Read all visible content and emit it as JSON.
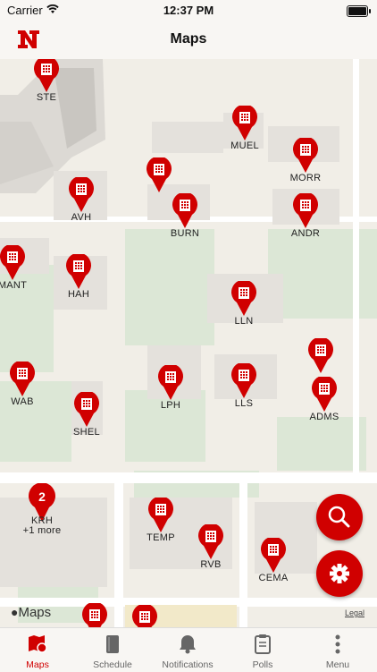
{
  "status": {
    "carrier": "Carrier",
    "time": "12:37 PM"
  },
  "header": {
    "title": "Maps"
  },
  "map": {
    "attribution": "Maps",
    "legal": "Legal",
    "pins": [
      {
        "label": "STE"
      },
      {
        "label": "MUEL"
      },
      {
        "label": "MORR"
      },
      {
        "label": "AVH"
      },
      {
        "label": "BURN"
      },
      {
        "label": "ANDR"
      },
      {
        "label": "MANT"
      },
      {
        "label": "HAH"
      },
      {
        "label": "LLN"
      },
      {
        "label": "WAB"
      },
      {
        "label": "LPH"
      },
      {
        "label": "LLS"
      },
      {
        "label": "ADMS"
      },
      {
        "label": "SHEL"
      },
      {
        "label": "TEMP"
      },
      {
        "label": "RVB"
      },
      {
        "label": "CEMA"
      }
    ],
    "cluster": {
      "count": "2",
      "label": "KRH",
      "more": "+1 more"
    }
  },
  "fabs": {
    "search_icon": "search-icon",
    "settings_icon": "gear-icon"
  },
  "tabs": [
    {
      "label": "Maps",
      "icon": "map-pin-icon"
    },
    {
      "label": "Schedule",
      "icon": "book-icon"
    },
    {
      "label": "Notifications",
      "icon": "bell-icon"
    },
    {
      "label": "Polls",
      "icon": "clipboard-icon"
    },
    {
      "label": "Menu",
      "icon": "more-vertical-icon"
    }
  ],
  "colors": {
    "accent": "#d00000"
  }
}
